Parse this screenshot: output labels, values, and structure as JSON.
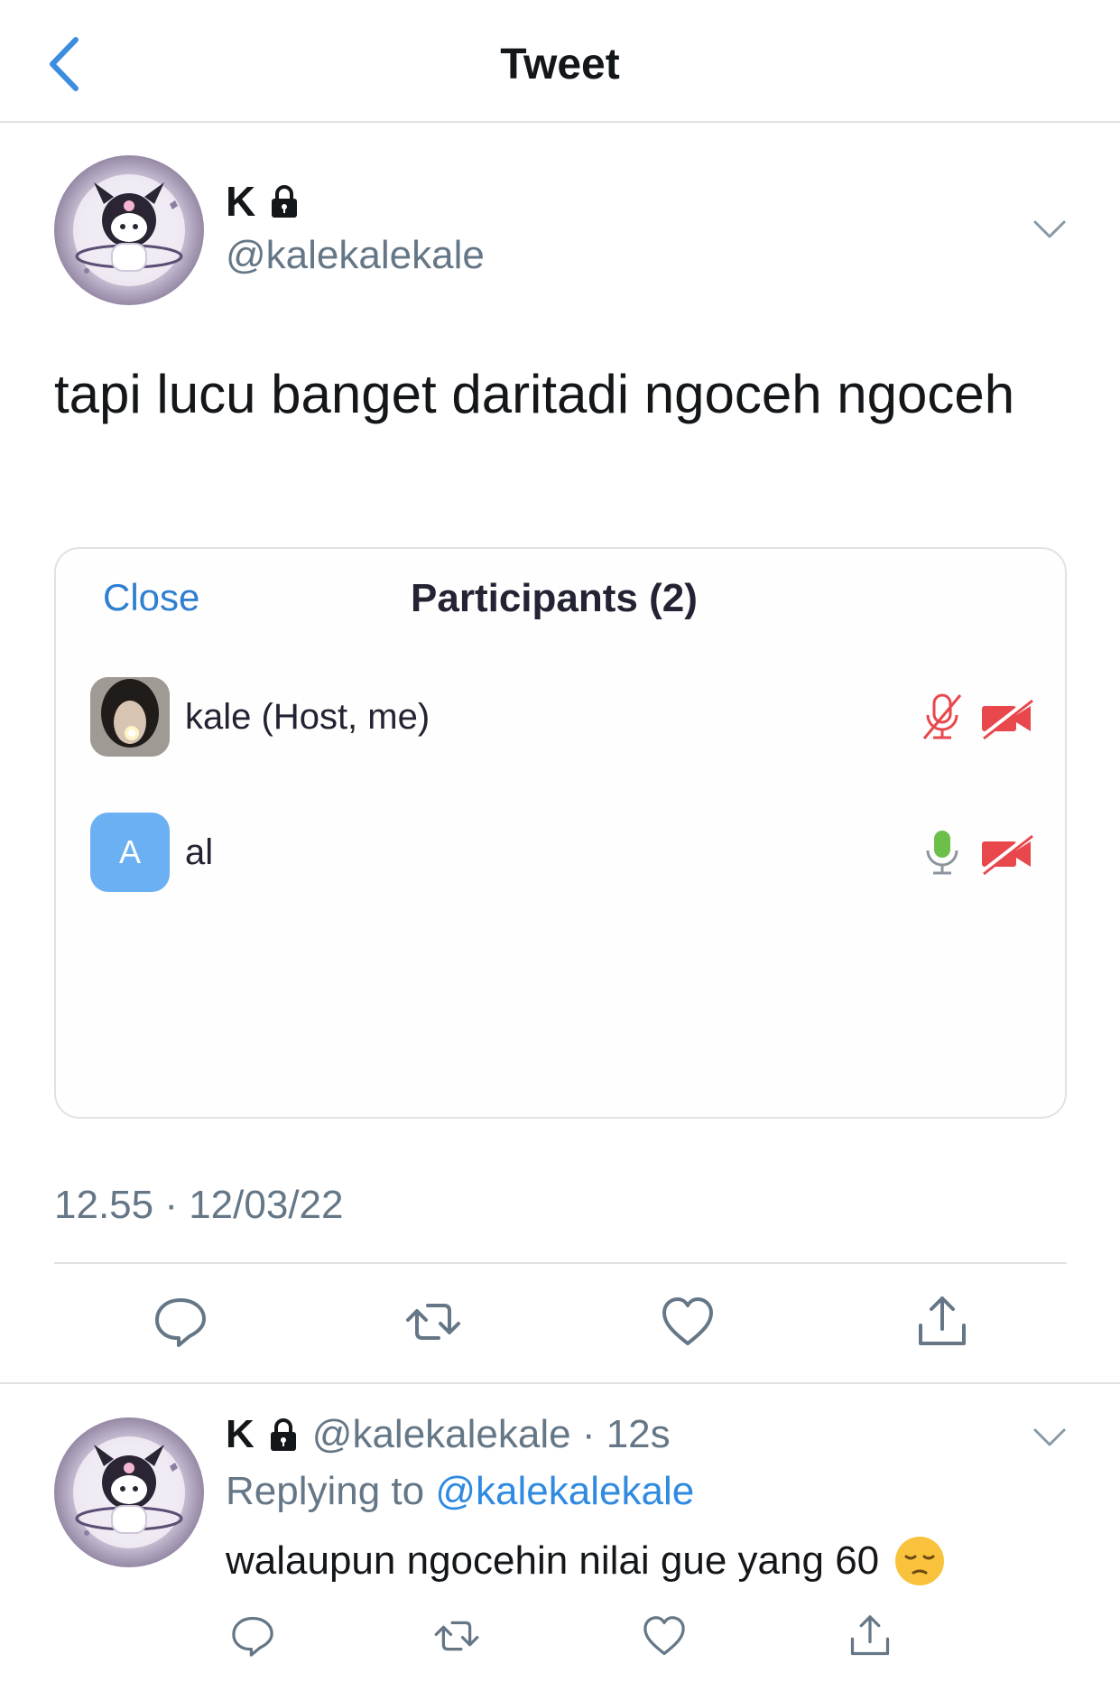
{
  "header": {
    "title": "Tweet",
    "back_icon": "chevron-left-icon"
  },
  "tweet": {
    "author_name": "K",
    "author_handle": "@kalekalekale",
    "text": "tapi lucu banget daritadi ngoceh ngoceh",
    "timestamp": "12.55 · 12/03/22"
  },
  "card": {
    "close_label": "Close",
    "title": "Participants (2)",
    "participants": [
      {
        "name": "kale (Host, me)",
        "mic": "muted",
        "video": "off"
      },
      {
        "name": "al",
        "avatar_letter": "A",
        "mic": "active",
        "video": "off"
      }
    ]
  },
  "actions": [
    "reply-icon",
    "retweet-icon",
    "like-icon",
    "share-icon"
  ],
  "reply": {
    "author_name": "K",
    "meta": "@kalekalekale · 12s",
    "replying_prefix": "Replying to",
    "replying_mention": "@kalekalekale",
    "text": "walaupun ngocehin nilai gue yang 60"
  },
  "colors": {
    "accent": "#2f8ae0",
    "muted_red": "#e8474c",
    "mic_green": "#6cc04a",
    "secondary_text": "#657786",
    "avatar_blue": "#6bb0f2"
  }
}
